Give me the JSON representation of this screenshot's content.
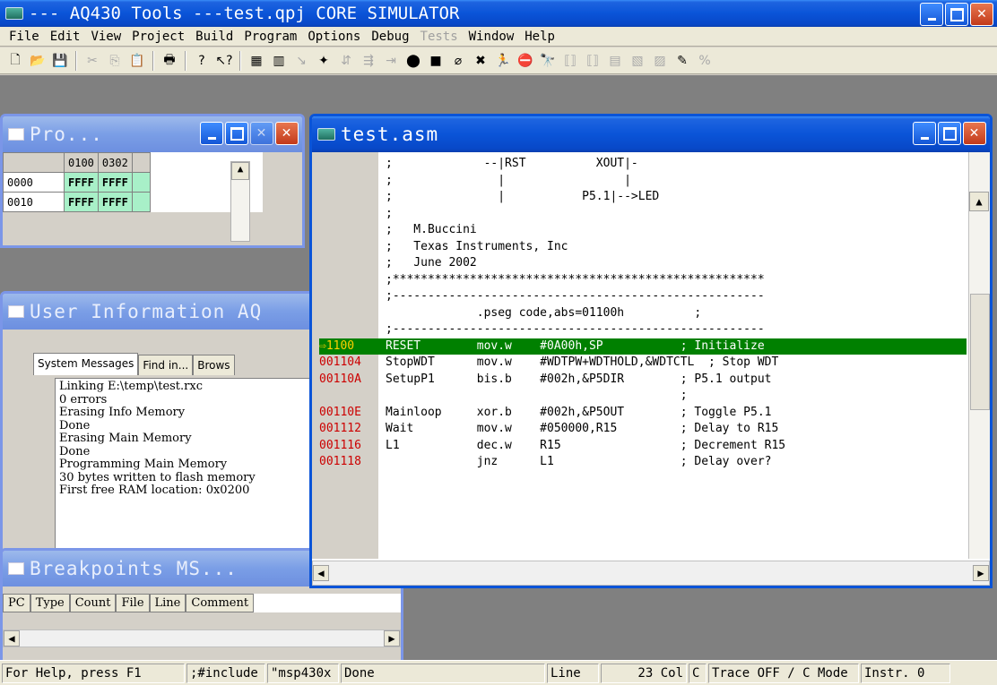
{
  "app": {
    "title": "--- AQ430 Tools ---test.qpj CORE SIMULATOR"
  },
  "menu": [
    "File",
    "Edit",
    "View",
    "Project",
    "Build",
    "Program",
    "Options",
    "Debug",
    "Tests",
    "Window",
    "Help"
  ],
  "menu_disabled": [
    "Tests"
  ],
  "program_window": {
    "title": "Pro...",
    "columns": [
      "0100",
      "0302"
    ],
    "rows": [
      {
        "addr": "0000",
        "values": [
          "FFFF",
          "FFFF"
        ]
      },
      {
        "addr": "0010",
        "values": [
          "FFFF",
          "FFFF"
        ]
      }
    ]
  },
  "user_info_window": {
    "title": "User Information AQ",
    "tabs": [
      "System Messages",
      "Find in...",
      "Brows"
    ],
    "messages": [
      "Linking E:\\temp\\test.rxc",
      "0 errors",
      "Erasing Info Memory",
      "Done",
      "Erasing Main Memory",
      "Done",
      "Programming Main Memory",
      "30 bytes written to flash memory",
      "First free RAM location: 0x0200"
    ]
  },
  "breakpoints_window": {
    "title": "Breakpoints MS...",
    "columns": [
      "PC",
      "Type",
      "Count",
      "File",
      "Line",
      "Comment"
    ]
  },
  "editor": {
    "title": "test.asm",
    "lines": [
      {
        "addr": "",
        "text": ";             --|RST          XOUT|-"
      },
      {
        "addr": "",
        "text": ";               |                 |"
      },
      {
        "addr": "",
        "text": ";               |           P5.1|-->LED"
      },
      {
        "addr": "",
        "text": ";"
      },
      {
        "addr": "",
        "text": ";   M.Buccini"
      },
      {
        "addr": "",
        "text": ";   Texas Instruments, Inc"
      },
      {
        "addr": "",
        "text": ";   June 2002"
      },
      {
        "addr": "",
        "text": ";*****************************************************"
      },
      {
        "addr": "",
        "text": ";-----------------------------------------------------"
      },
      {
        "addr": "",
        "text": "             .pseg code,abs=01100h          ;"
      },
      {
        "addr": "",
        "text": ";-----------------------------------------------------"
      },
      {
        "addr": "1100",
        "text": "RESET        mov.w    #0A00h,SP           ; Initialize",
        "current": true
      },
      {
        "addr": "001104",
        "text": "StopWDT      mov.w    #WDTPW+WDTHOLD,&WDTCTL  ; Stop WDT"
      },
      {
        "addr": "00110A",
        "text": "SetupP1      bis.b    #002h,&P5DIR        ; P5.1 output"
      },
      {
        "addr": "",
        "text": "                                          ;"
      },
      {
        "addr": "00110E",
        "text": "Mainloop     xor.b    #002h,&P5OUT        ; Toggle P5.1"
      },
      {
        "addr": "001112",
        "text": "Wait         mov.w    #050000,R15         ; Delay to R15"
      },
      {
        "addr": "001116",
        "text": "L1           dec.w    R15                 ; Decrement R15"
      },
      {
        "addr": "001118",
        "text": "             jnz      L1                  ; Delay over?"
      }
    ]
  },
  "status": {
    "help": "For Help, press F1",
    "include": ";#include",
    "file": "\"msp430x",
    "done": "Done",
    "line_label": "Line",
    "line_col": "23 Col",
    "c_mark": "C",
    "trace": "Trace OFF / C Mode",
    "instr": "Instr. 0"
  }
}
